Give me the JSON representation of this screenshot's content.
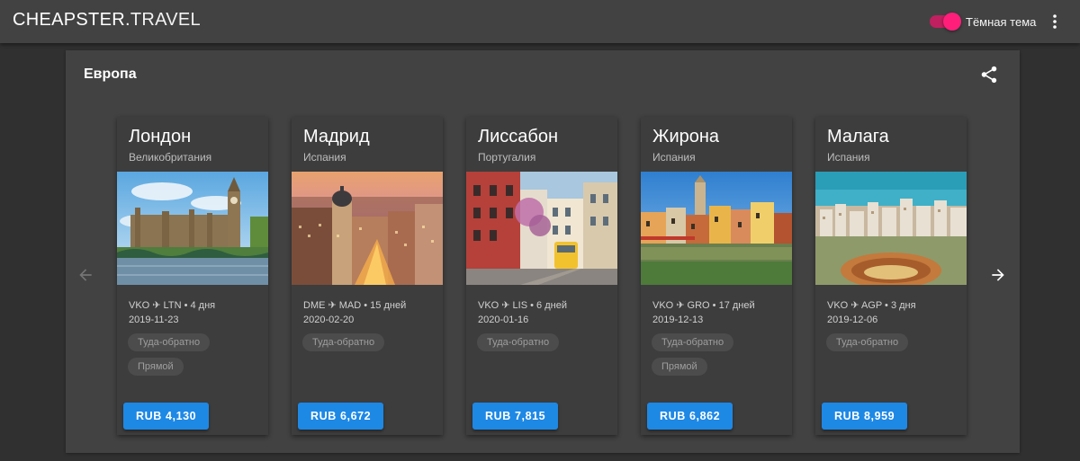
{
  "app": {
    "logo_bold": "CHEAPSTER.",
    "logo_light": "TRAVEL",
    "theme_label": "Тёмная тема",
    "theme_on": true,
    "accent": "#ff1f7a",
    "button_color": "#1e88e5"
  },
  "section": {
    "title": "Европа"
  },
  "cards": [
    {
      "city": "Лондон",
      "country": "Великобритания",
      "route": "VKO ✈ LTN • 4 дня",
      "date": "2019-11-23",
      "chip1": "Туда-обратно",
      "chip2": "Прямой",
      "price": "RUB 4,130",
      "photo": "london-image"
    },
    {
      "city": "Мадрид",
      "country": "Испания",
      "route": "DME ✈ MAD • 15 дней",
      "date": "2020-02-20",
      "chip1": "Туда-обратно",
      "price": "RUB 6,672",
      "photo": "madrid-image"
    },
    {
      "city": "Лиссабон",
      "country": "Португалия",
      "route": "VKO ✈ LIS • 6 дней",
      "date": "2020-01-16",
      "chip1": "Туда-обратно",
      "price": "RUB 7,815",
      "photo": "lisbon-image"
    },
    {
      "city": "Жирона",
      "country": "Испания",
      "route": "VKO ✈ GRO • 17 дней",
      "date": "2019-12-13",
      "chip1": "Туда-обратно",
      "chip2": "Прямой",
      "price": "RUB 6,862",
      "photo": "girona-image"
    },
    {
      "city": "Малага",
      "country": "Испания",
      "route": "VKO ✈ AGP • 3 дня",
      "date": "2019-12-06",
      "chip1": "Туда-обратно",
      "price": "RUB 8,959",
      "photo": "malaga-image"
    }
  ],
  "icons": {
    "menu": "more-vert-icon",
    "share": "share-icon",
    "prev": "arrow-left-icon",
    "next": "arrow-right-icon"
  }
}
